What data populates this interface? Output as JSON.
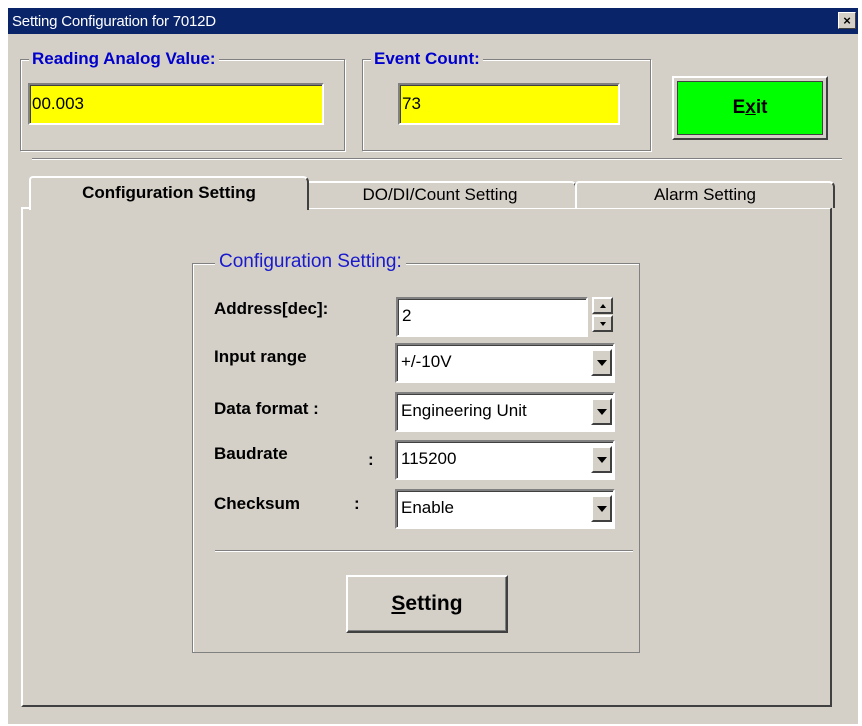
{
  "window": {
    "title": "Setting Configuration for 7012D",
    "close_glyph": "×"
  },
  "reading": {
    "label": "Reading  Analog Value:",
    "value": "00.003"
  },
  "event": {
    "label": "Event Count:",
    "value": "73"
  },
  "exit_button": {
    "pre": "E",
    "accel": "x",
    "post": "it"
  },
  "tabs": [
    {
      "label": "Configuration Setting",
      "active": true
    },
    {
      "label": "DO/DI/Count Setting",
      "active": false
    },
    {
      "label": "Alarm Setting",
      "active": false
    }
  ],
  "config": {
    "title": "Configuration Setting:",
    "address": {
      "label": "Address[dec]:",
      "value": "2"
    },
    "input_range": {
      "label": "Input range",
      "value": "+/-10V"
    },
    "data_format": {
      "label": "Data format :",
      "value": "Engineering Unit"
    },
    "baudrate": {
      "label": "Baudrate",
      "colon": ":",
      "value": "115200"
    },
    "checksum": {
      "label": "Checksum",
      "colon": ":",
      "value": "Enable"
    },
    "setting_button": {
      "accel": "S",
      "rest": "etting"
    }
  },
  "colors": {
    "titlebar": "#0a246a",
    "field_yellow": "#ffff00",
    "exit_green": "#00ff00",
    "legend_blue": "#0000cc"
  },
  "icons": {
    "close": "close-icon",
    "dropdown": "chevron-down-icon",
    "spin_up": "spin-up-icon",
    "spin_down": "spin-down-icon"
  }
}
